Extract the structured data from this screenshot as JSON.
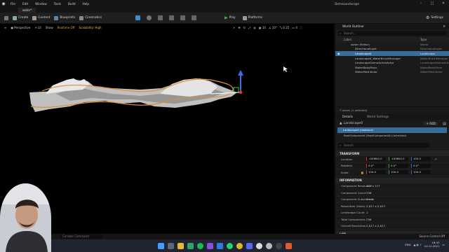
{
  "menu": {
    "items": [
      "File",
      "Edit",
      "Window",
      "Tools",
      "Build",
      "Help"
    ],
    "window_title": "DemoLandscape",
    "level_tab": "water*"
  },
  "toolbar": {
    "create": "Create",
    "content": "Content",
    "blueprints": "Blueprints",
    "cinematics": "Cinematics",
    "play": "Play",
    "platforms": "Platforms",
    "settings": "Settings"
  },
  "viewport": {
    "perspective": "Perspective",
    "lit": "Lit",
    "show": "Show",
    "realtime": "Realtime Off",
    "scalability": "Scalability: High",
    "grid": "10",
    "angle": "10°",
    "scale": "0.25",
    "camera": "4"
  },
  "outliner": {
    "tab": "World Outliner",
    "search_placeholder": "Search...",
    "col_label": "Label",
    "col_type": "Type",
    "rows": [
      {
        "label": "water (Editor)",
        "type": "World",
        "indent": 0,
        "selected": false
      },
      {
        "label": "DirectionalLight",
        "type": "DirectionalLight",
        "indent": 1,
        "selected": false
      },
      {
        "label": "Landscape0",
        "type": "Landscape",
        "indent": 1,
        "selected": true
      },
      {
        "label": "Landscape0_WaterBrushManager",
        "type": "WaterBrushManager",
        "indent": 1,
        "selected": false
      },
      {
        "label": "LandscapeGizmoActiveActor",
        "type": "LandscapeGizmoActive",
        "indent": 1,
        "selected": false
      },
      {
        "label": "WaterBodyRiver",
        "type": "WaterBodyRiver",
        "indent": 1,
        "selected": false
      },
      {
        "label": "WaterMeshActor",
        "type": "WaterMeshActor",
        "indent": 1,
        "selected": false
      }
    ],
    "footer": "7 actors (1 selected)"
  },
  "details": {
    "tab_details": "Details",
    "tab_world_settings": "World Settings",
    "actor_name": "Landscape0",
    "add_label": "+ ADD",
    "instance_row": "Landscape0 (Instance)",
    "root_row": "RootComponent (RootComponent0) (Inherited)",
    "search_placeholder": "Search",
    "transform_header": "TRANSFORM",
    "location": {
      "label": "Location",
      "x": "-100800.0",
      "y": "-100800.0",
      "z": "100.0"
    },
    "rotation": {
      "label": "Rotation",
      "x": "0.0°",
      "y": "0.0°",
      "z": "0.0°"
    },
    "scale": {
      "label": "Scale",
      "x": "100.0",
      "y": "100.0",
      "z": "100.0"
    },
    "info_header": "INFORMATION",
    "info": [
      {
        "key": "Component Resolution",
        "value": "127 x 127"
      },
      {
        "key": "Component Count",
        "value": "256"
      },
      {
        "key": "Component Subsections",
        "value": "2 x 2"
      },
      {
        "key": "Resolution (Verts)",
        "value": "2,017 x 2,017"
      },
      {
        "key": "Landscape Count",
        "value": "1"
      },
      {
        "key": "Total Components",
        "value": "256"
      },
      {
        "key": "Overall Resolution",
        "value": "2,017 x 2,017"
      }
    ],
    "lod_header": "LOD"
  },
  "status": {
    "cmd": "Console Command",
    "source": "Source Control Off"
  },
  "clock": {
    "time": "16:47",
    "date": "10.11.2021",
    "lang": "ENG"
  },
  "colors": {
    "accent_blue": "#3a6c9a",
    "play_green": "#52b352",
    "spline_orange": "#d9903a"
  }
}
